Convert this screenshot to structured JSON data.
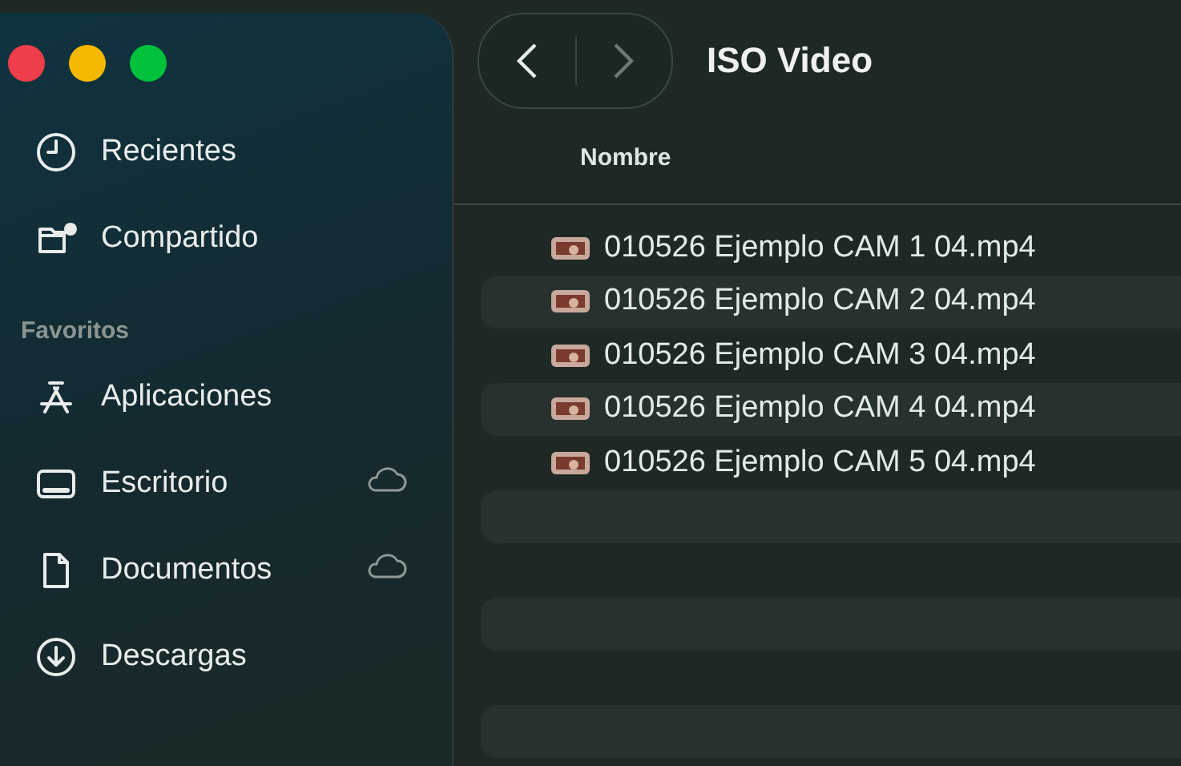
{
  "sidebar": {
    "items": [
      {
        "label": "Recientes",
        "cloud": false
      },
      {
        "label": "Compartido",
        "cloud": false
      }
    ],
    "sections": [
      {
        "title": "Favoritos",
        "items": [
          {
            "label": "Aplicaciones",
            "cloud": false
          },
          {
            "label": "Escritorio",
            "cloud": true
          },
          {
            "label": "Documentos",
            "cloud": true
          },
          {
            "label": "Descargas",
            "cloud": false
          }
        ]
      }
    ]
  },
  "toolbar": {
    "title": "ISO Video"
  },
  "table": {
    "columns": [
      "Nombre"
    ],
    "rows": [
      {
        "name": "010526 Ejemplo CAM 1 04.mp4"
      },
      {
        "name": "010526 Ejemplo CAM 2 04.mp4"
      },
      {
        "name": "010526 Ejemplo CAM 3 04.mp4"
      },
      {
        "name": "010526 Ejemplo CAM 4 04.mp4"
      },
      {
        "name": "010526 Ejemplo CAM 5 04.mp4"
      }
    ]
  }
}
